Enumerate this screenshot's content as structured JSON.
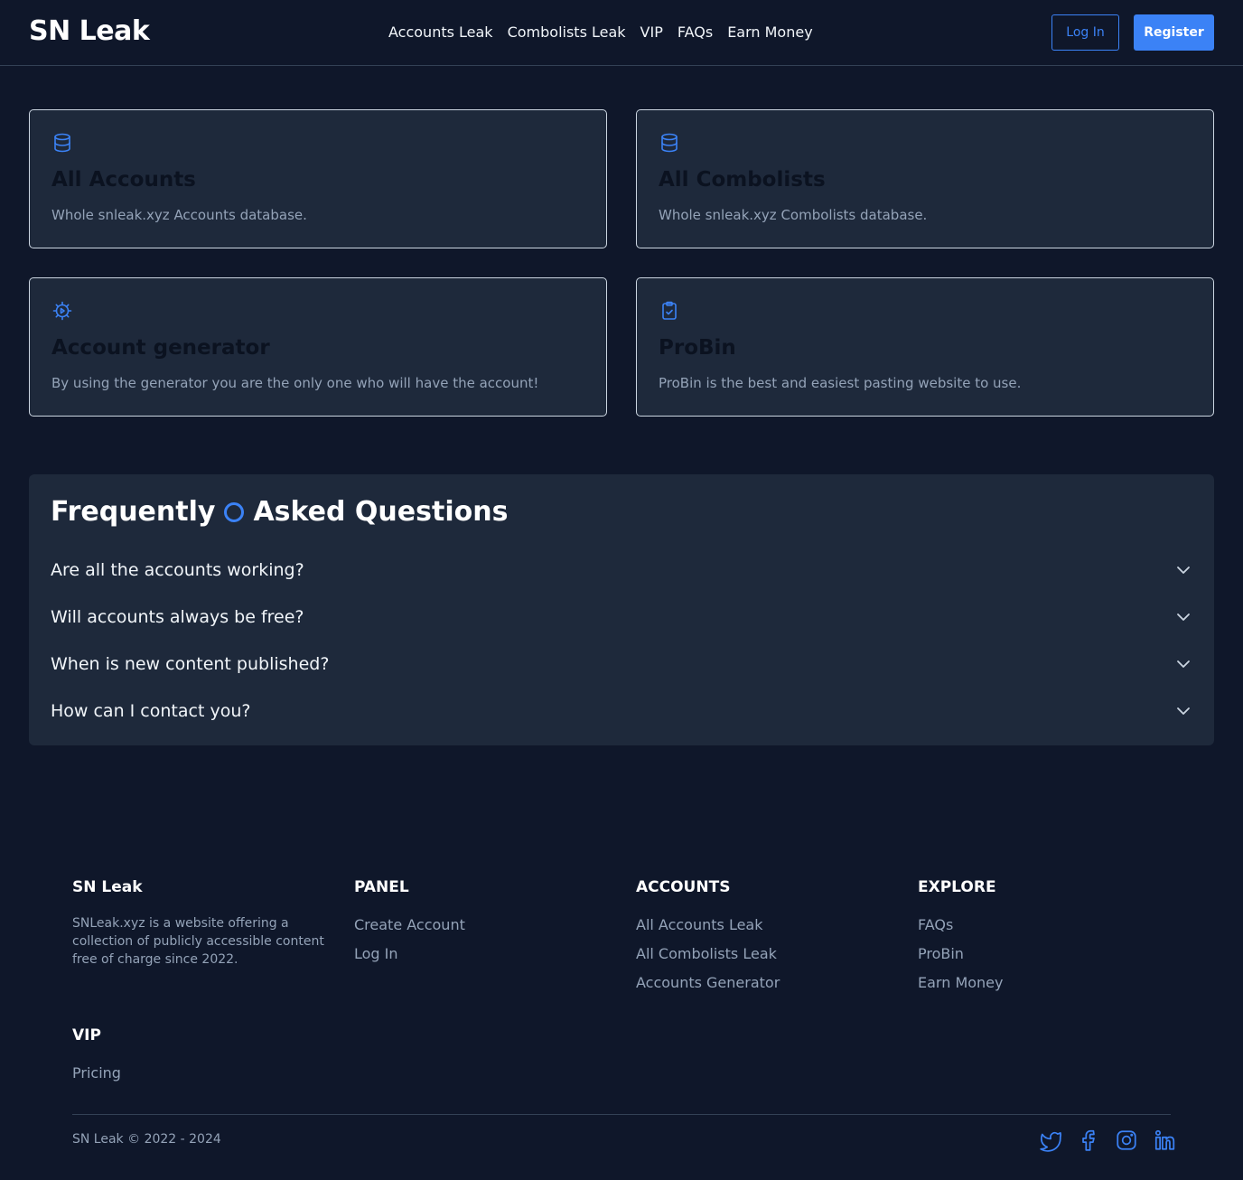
{
  "header": {
    "logo": "SN Leak",
    "nav": [
      "Accounts Leak",
      "Combolists Leak",
      "VIP",
      "FAQs",
      "Earn Money"
    ],
    "login_label": "Log In",
    "register_label": "Register"
  },
  "cards": [
    {
      "icon": "database-icon",
      "title": "All Accounts",
      "desc": "Whole snleak.xyz Accounts database."
    },
    {
      "icon": "database-icon",
      "title": "All Combolists",
      "desc": "Whole snleak.xyz Combolists database."
    },
    {
      "icon": "gear-icon",
      "title": "Account generator",
      "desc": "By using the generator you are the only one who will have the account!"
    },
    {
      "icon": "clipboard-check-icon",
      "title": "ProBin",
      "desc": "ProBin is the best and easiest pasting website to use."
    }
  ],
  "faq": {
    "title_part1": "Frequently",
    "title_part2": "Asked Questions",
    "questions": [
      "Are all the accounts working?",
      "Will accounts always be free?",
      "When is new content published?",
      "How can I contact you?"
    ]
  },
  "footer": {
    "brand": {
      "heading": "SN Leak",
      "text": "SNLeak.xyz is a website offering a collection of publicly accessible content free of charge since 2022."
    },
    "panel": {
      "heading": "PANEL",
      "links": [
        "Create Account",
        "Log In"
      ]
    },
    "accounts": {
      "heading": "ACCOUNTS",
      "links": [
        "All Accounts Leak",
        "All Combolists Leak",
        "Accounts Generator"
      ]
    },
    "explore": {
      "heading": "EXPLORE",
      "links": [
        "FAQs",
        "ProBin",
        "Earn Money"
      ]
    },
    "vip": {
      "heading": "VIP",
      "links": [
        "Pricing"
      ]
    },
    "copyright": "SN Leak © 2022 - 2024",
    "socials": [
      "twitter-icon",
      "facebook-icon",
      "instagram-icon",
      "linkedin-icon"
    ]
  },
  "colors": {
    "background": "#0f172a",
    "surface": "#1e293b",
    "accent": "#3b82f6"
  }
}
